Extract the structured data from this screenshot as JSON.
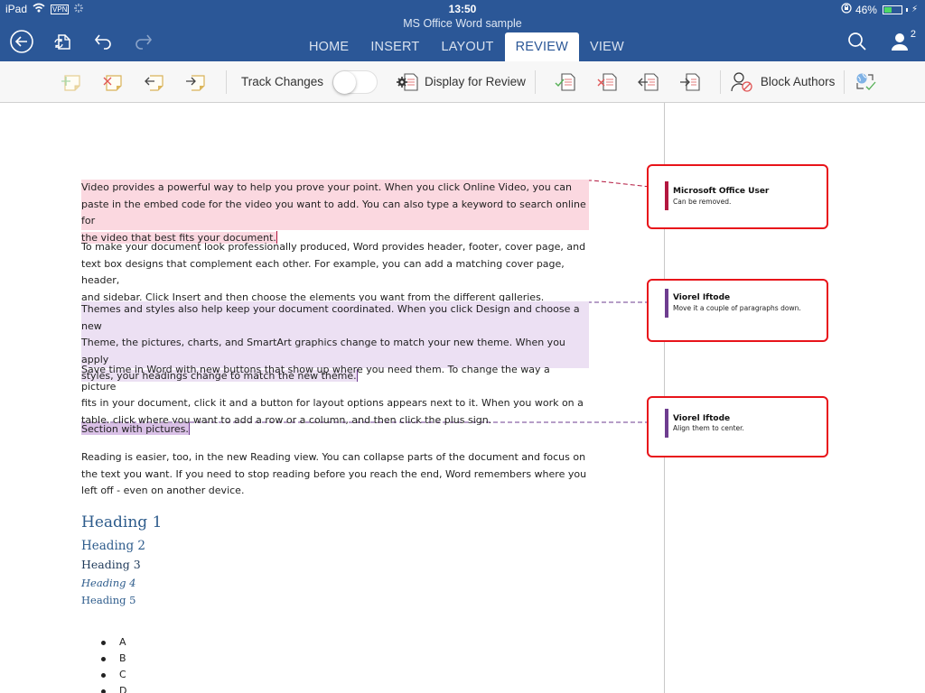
{
  "status_bar": {
    "device": "iPad",
    "vpn": "VPN",
    "time": "13:50",
    "battery_percent": "46%",
    "battery_level": 0.46
  },
  "header": {
    "doc_title": "MS Office Word sample",
    "icons": [
      "back-icon",
      "sync-icon",
      "undo-icon",
      "redo-icon",
      "search-icon",
      "share-people-icon"
    ],
    "share_count": "2"
  },
  "tabs": [
    {
      "label": "HOME",
      "active": false
    },
    {
      "label": "INSERT",
      "active": false
    },
    {
      "label": "LAYOUT",
      "active": false
    },
    {
      "label": "REVIEW",
      "active": true
    },
    {
      "label": "VIEW",
      "active": false
    }
  ],
  "ribbon": {
    "track_changes_label": "Track Changes",
    "track_changes_on": false,
    "display_for_review_label": "Display for Review",
    "block_authors_label": "Block Authors"
  },
  "document": {
    "paragraphs": [
      {
        "lines": [
          "Video provides a powerful way to help you prove your point. When you click Online Video, you can",
          "paste in the embed code for the video you want to add. You can also type a keyword to search online for",
          "the video that best fits your document."
        ],
        "comment": 0
      },
      {
        "lines": [
          "To make your document look professionally produced, Word provides header, footer, cover page, and",
          "text box designs that complement each other. For example, you can add a matching cover page, header,",
          "and sidebar. Click Insert and then choose the elements you want from the different galleries."
        ]
      },
      {
        "lines": [
          "Themes and styles also help keep your document coordinated. When you click Design and choose a new",
          "Theme, the pictures, charts, and SmartArt graphics change to match your new theme. When you apply",
          "styles, your headings change to match the new theme."
        ],
        "comment": 1
      },
      {
        "lines": [
          "Save time in Word with new buttons that show up where you need them. To change the way a picture",
          "fits in your document, click it and a button for layout options appears next to it. When you work on a",
          "table, click where you want to add a row or a column, and then click the plus sign."
        ]
      },
      {
        "lines": [
          "Section with pictures."
        ],
        "comment": 2
      },
      {
        "lines": [
          "Reading is easier, too, in the new Reading view. You can collapse parts of the document and focus on",
          "the text you want. If you need to stop reading before you reach the end, Word remembers where you",
          "left off - even on another device."
        ]
      }
    ],
    "headings": [
      "Heading 1",
      "Heading 2",
      "Heading 3",
      "Heading 4",
      "Heading 5"
    ],
    "bullets": [
      "A",
      "B",
      "C",
      "D"
    ]
  },
  "comments": [
    {
      "author": "Microsoft Office User",
      "text": "Can be removed.",
      "color": "#b3173f"
    },
    {
      "author": "Viorel Iftode",
      "text": "Move it a couple of paragraphs down.",
      "color": "#6e3d8f"
    },
    {
      "author": "Viorel Iftode",
      "text": "Align them to center.",
      "color": "#6e3d8f"
    }
  ],
  "colors": {
    "brand": "#2b5797",
    "comment_border": "#e8141a",
    "highlight_pink": "#fbd8e0",
    "highlight_purple": "#ece0f3",
    "heading_blue": "#2e5c8c"
  }
}
